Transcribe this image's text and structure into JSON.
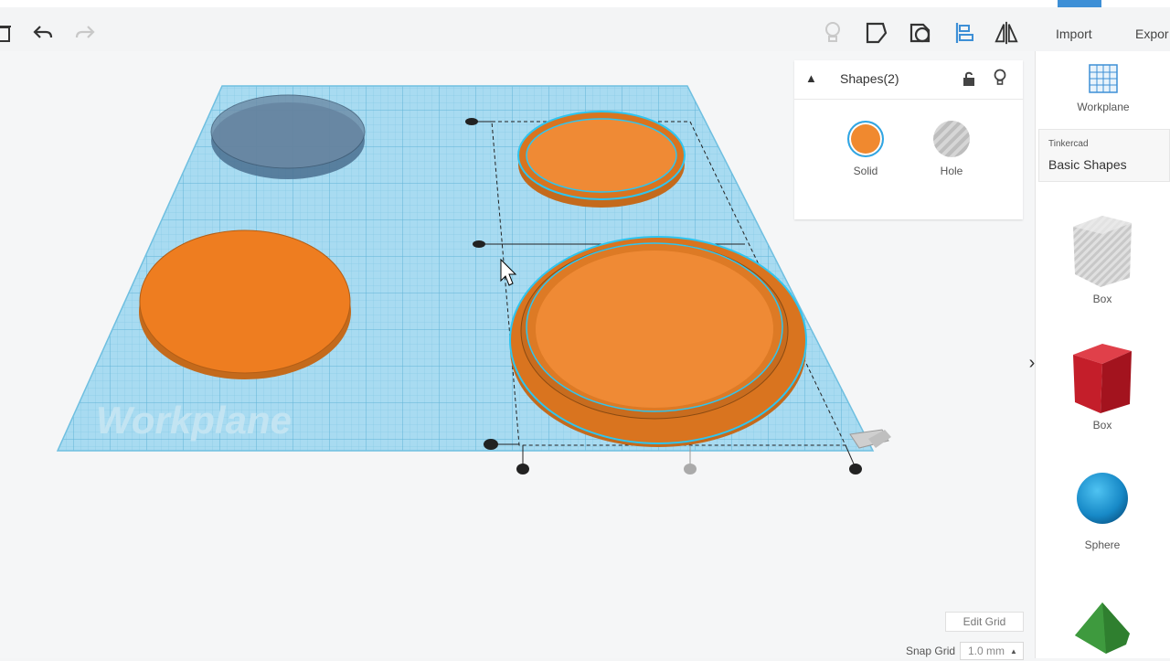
{
  "toolbar": {
    "undo": "undo-icon",
    "redo": "redo-icon",
    "delete": "trash-icon",
    "import_label": "Import",
    "export_label": "Expor",
    "tools": [
      "light-bulb-icon",
      "note-icon",
      "group-icon",
      "align-icon",
      "mirror-icon"
    ]
  },
  "canvas": {
    "workplane_label": "Workplane"
  },
  "inspector": {
    "title": "Shapes(2)",
    "options": [
      {
        "label": "Solid",
        "color": "#f0892f"
      },
      {
        "label": "Hole",
        "color": "#cfcfcf"
      }
    ]
  },
  "sidebar": {
    "workplane_label": "Workplane",
    "library_brand": "Tinkercad",
    "library_name": "Basic Shapes",
    "shapes": [
      {
        "label": "Box",
        "icon": "hole-box-icon"
      },
      {
        "label": "Box",
        "icon": "red-box-icon"
      },
      {
        "label": "Sphere",
        "icon": "sphere-icon"
      },
      {
        "label": "",
        "icon": "roof-icon"
      }
    ]
  },
  "grid": {
    "edit_label": "Edit Grid",
    "snap_label": "Snap Grid",
    "snap_value": "1.0 mm"
  },
  "colors": {
    "accent": "#3d8fd6",
    "solid_orange": "#ef8a2f",
    "workplane_blue": "#9fd6ef",
    "selection_cyan": "#2ec5f0"
  }
}
